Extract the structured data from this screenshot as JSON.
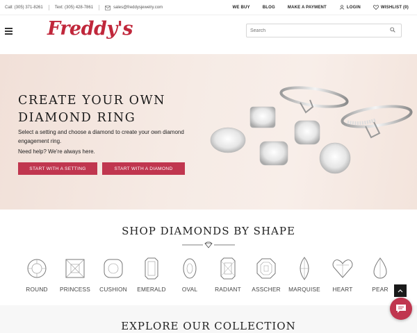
{
  "topbar": {
    "call": "Call: (305) 371-8261",
    "text": "Text: (305) 428-7861",
    "email": "sales@freddysjewelry.com",
    "we_buy": "WE BUY",
    "blog": "BLOG",
    "payment": "MAKE A PAYMENT",
    "login": "LOGIN",
    "wishlist": "WISHLIST (0)"
  },
  "header": {
    "logo": "Freddy's",
    "search_placeholder": "Search"
  },
  "hero": {
    "title_line1": "CREATE YOUR OWN",
    "title_line2": "DIAMOND RING",
    "description": "Select a setting and choose a diamond to create your own diamond engagement ring.",
    "help": "Need help? We're always here.",
    "btn_setting": "START WITH A SETTING",
    "btn_diamond": "START WITH A DIAMOND"
  },
  "shapes_section": {
    "title": "SHOP DIAMONDS BY SHAPE",
    "shapes": [
      "ROUND",
      "PRINCESS",
      "CUSHION",
      "EMERALD",
      "OVAL",
      "RADIANT",
      "ASSCHER",
      "MARQUISE",
      "HEART",
      "PEAR"
    ]
  },
  "collection": {
    "title": "EXPLORE OUR COLLECTION"
  },
  "colors": {
    "brand": "#c0273b",
    "button": "#c0364f"
  }
}
